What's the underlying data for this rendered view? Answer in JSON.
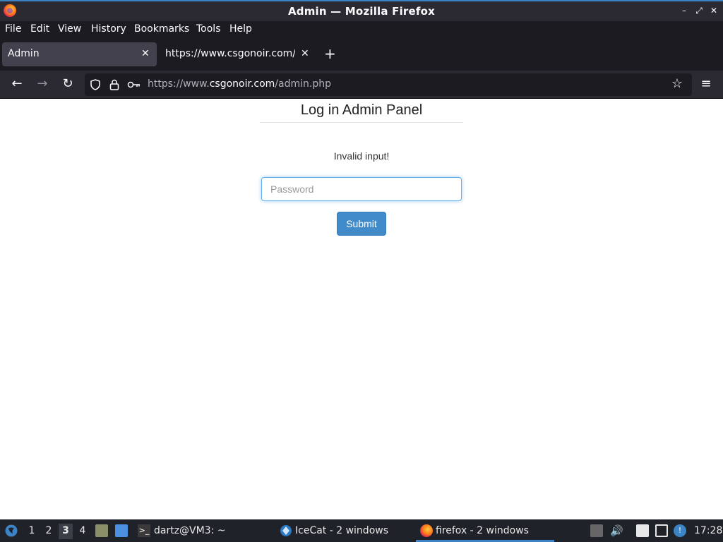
{
  "window": {
    "title": "Admin — Mozilla Firefox"
  },
  "menu": [
    "File",
    "Edit",
    "View",
    "History",
    "Bookmarks",
    "Tools",
    "Help"
  ],
  "tabs": [
    {
      "label": "Admin",
      "active": true
    },
    {
      "label": "https://www.csgonoir.com/admin.php",
      "active": false
    }
  ],
  "url": {
    "prefix": "https://www.",
    "host": "csgonoir.com",
    "path": "/admin.php"
  },
  "page": {
    "heading": "Log in Admin Panel",
    "message": "Invalid input!",
    "password_placeholder": "Password",
    "password_value": "",
    "submit_label": "Submit"
  },
  "taskbar": {
    "workspaces": [
      "1",
      "2",
      "3",
      "4"
    ],
    "active_workspace": "3",
    "terminal": "dartz@VM3: ~",
    "icecat": "IceCat - 2 windows",
    "firefox": "firefox - 2 windows",
    "clock": "17:28"
  },
  "colors": {
    "accent": "#3d84c6",
    "button": "#428bca",
    "focus": "#66afe9"
  }
}
